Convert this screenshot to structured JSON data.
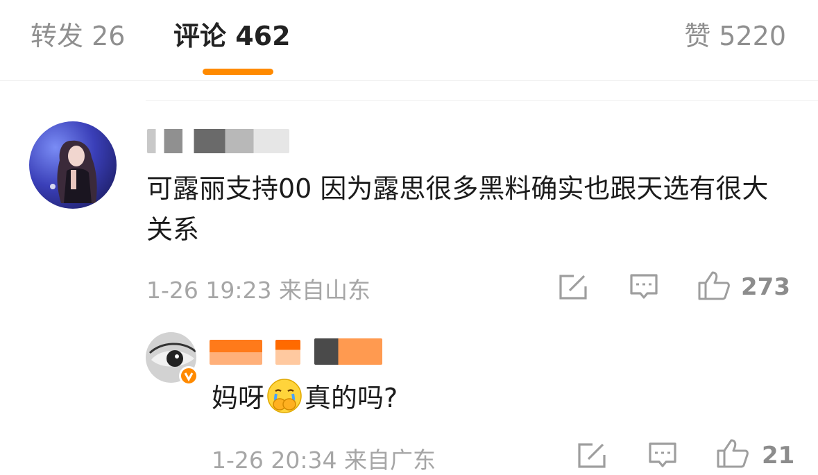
{
  "tabs": {
    "repost": "转发 26",
    "comment": "评论 462",
    "like": "赞 5220",
    "indicator_color": "#ff8a00"
  },
  "comments": [
    {
      "text": "可露丽支持00  因为露思很多黑料确实也跟天选有很大关系",
      "time_location": "1-26 19:23 来自山东",
      "like_count": "273"
    }
  ],
  "reply": {
    "text_before": "妈呀",
    "emoji": "crying-face-covering-mouth-emoji",
    "text_after": "真的吗?",
    "time_location": "1-26 20:34 来自广东",
    "like_count": "21",
    "badge": "verified-badge-icon"
  },
  "colors": {
    "accent": "#ff8a00",
    "meta_text": "#a6a6a6"
  }
}
